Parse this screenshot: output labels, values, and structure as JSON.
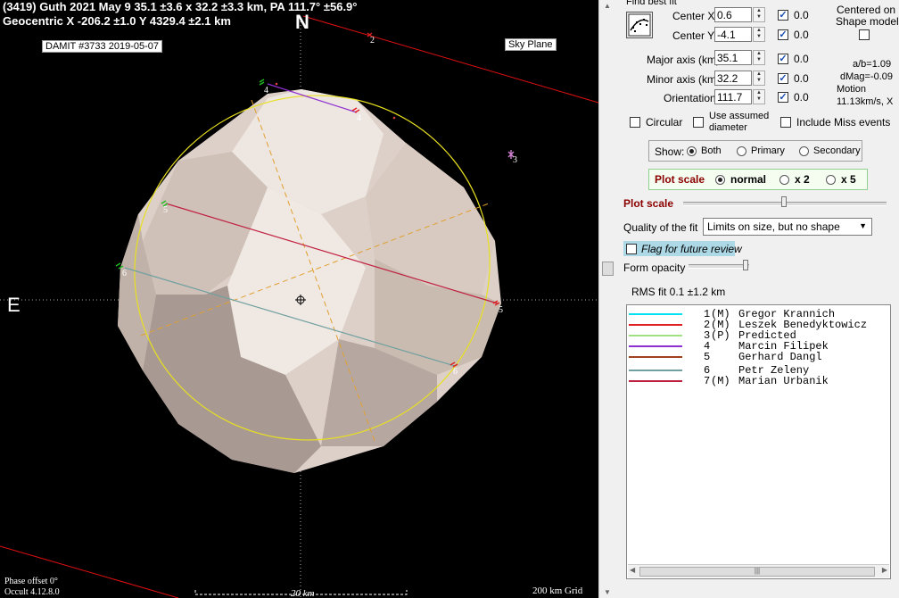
{
  "plot": {
    "title_line1": "(3419) Guth  2021 May 9   35.1 ±3.6 x 32.2 ±3.3 km, PA 111.7° ±56.9°",
    "title_line2": "Geocentric  X  -206.2 ±1.0  Y 4329.4 ±2.1 km",
    "damit_label": "DAMIT #3733 2019-05-07",
    "sky_plane_label": "Sky Plane",
    "north_label": "N",
    "east_label": "E",
    "phase_offset": "Phase offset 0°",
    "version": "Occult 4.12.8.0",
    "scale_bar_label": "20 km",
    "grid_label": "200 km Grid",
    "chord_numbers": [
      "2",
      "3",
      "4",
      "4",
      "5",
      "5",
      "6",
      "6"
    ],
    "colors": {
      "background": "#000000",
      "shape": "#e4d8d0",
      "ellipse": "#e8e020",
      "axes": "#e0a030"
    }
  },
  "panel": {
    "find_best_fit_label": "Find best fit",
    "find_best_fit_icon": "scatter-fit-icon",
    "center_x_label": "Center X",
    "center_x_value": "0.6",
    "center_x_check_value": "0.0",
    "center_y_label": "Center Y",
    "center_y_value": "-4.1",
    "center_y_check_value": "0.0",
    "major_axis_label": "Major axis (km)",
    "major_axis_value": "35.1",
    "major_axis_check_value": "0.0",
    "minor_axis_label": "Minor axis (km)",
    "minor_axis_value": "32.2",
    "minor_axis_check_value": "0.0",
    "orientation_label": "Orientation",
    "orientation_value": "111.7",
    "orientation_check_value": "0.0",
    "centered_on_label_1": "Centered on",
    "centered_on_label_2": "Shape model",
    "ab_ratio": "a/b=1.09",
    "dmag": "dMag=-0.09",
    "motion_label": "Motion",
    "motion_value": "11.13km/s, X",
    "circular_label": "Circular",
    "use_assumed_label_1": "Use assumed",
    "use_assumed_label_2": "diameter",
    "include_miss_label": "Include Miss events",
    "show_label": "Show:",
    "show_both": "Both",
    "show_primary": "Primary",
    "show_secondary": "Secondary",
    "plot_scale_group_label": "Plot scale",
    "scale_normal": "normal",
    "scale_x2": "x 2",
    "scale_x5": "x 5",
    "plot_scale_slider_label": "Plot scale",
    "quality_label": "Quality of the fit",
    "quality_value": "Limits on size, but no shape",
    "flag_review_label": "Flag for future review",
    "form_opacity_label": "Form opacity",
    "rms_fit": "RMS fit 0.1 ±1.2 km"
  },
  "legend": [
    {
      "num": "1",
      "flag": "(M)",
      "name": "Gregor Krannich",
      "color": "#00e0f0"
    },
    {
      "num": "2",
      "flag": "(M)",
      "name": "Leszek Benedyktowicz",
      "color": "#e02020"
    },
    {
      "num": "3",
      "flag": "(P)",
      "name": "Predicted",
      "color": "#a0e080"
    },
    {
      "num": "4",
      "flag": "",
      "name": "Marcin Filipek",
      "color": "#9030d0"
    },
    {
      "num": "5",
      "flag": "",
      "name": "Gerhard Dangl",
      "color": "#a04020"
    },
    {
      "num": "6",
      "flag": "",
      "name": "Petr Zeleny",
      "color": "#70a0a0"
    },
    {
      "num": "7",
      "flag": "(M)",
      "name": "Marian Urbanik",
      "color": "#c02040"
    }
  ]
}
